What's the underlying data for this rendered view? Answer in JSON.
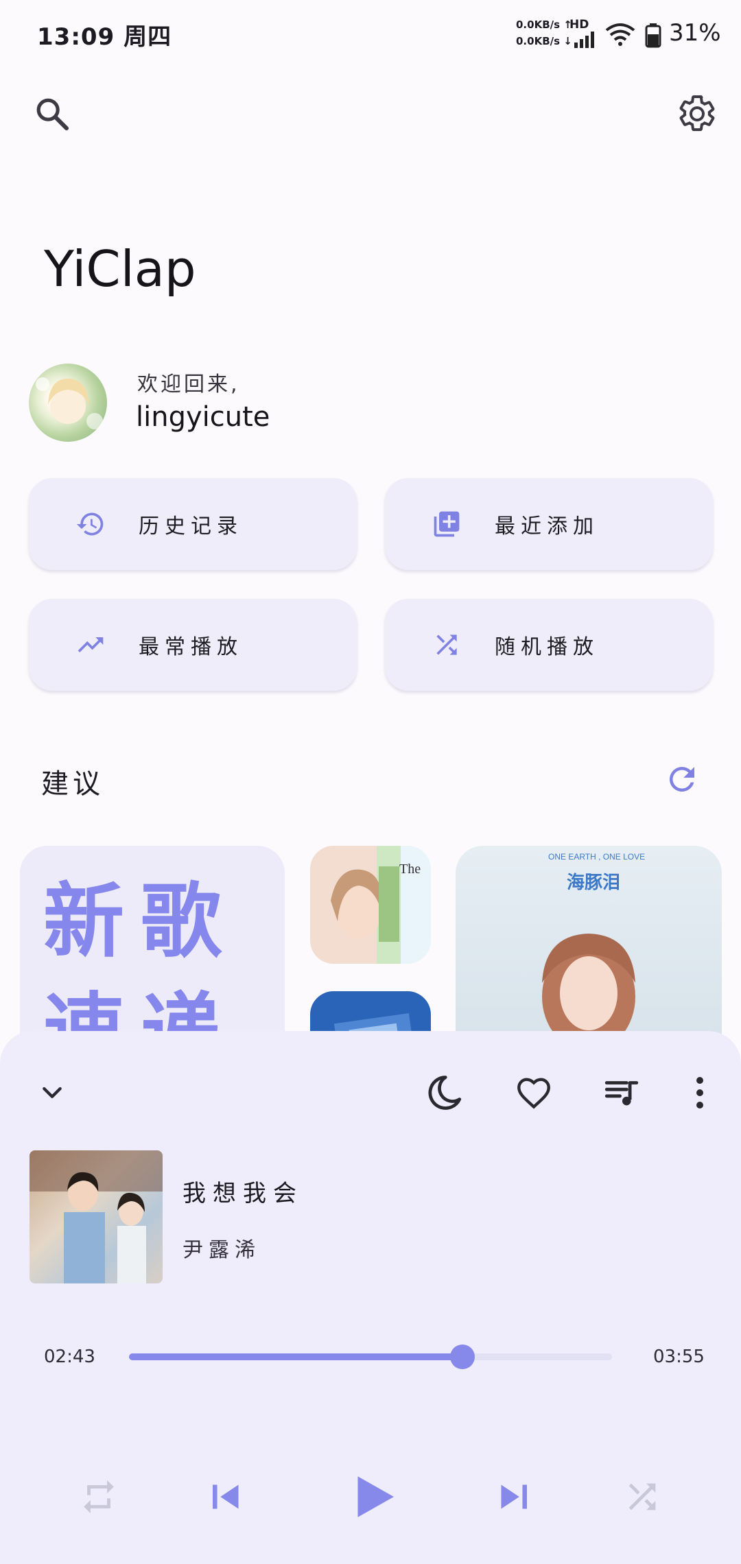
{
  "status_bar": {
    "time": "13:09",
    "weekday": "周四",
    "net_up": "0.0KB/s ↑",
    "net_down": "0.0KB/s ↓",
    "hd": "HD",
    "battery": "31%"
  },
  "header": {
    "search_icon": "search-icon",
    "settings_icon": "gear-icon"
  },
  "app": {
    "title": "YiClap"
  },
  "user": {
    "greeting": "欢迎回来,",
    "name": "lingyicute"
  },
  "quick_actions": [
    {
      "label": "历史记录",
      "icon": "history-icon"
    },
    {
      "label": "最近添加",
      "icon": "library-add-icon"
    },
    {
      "label": "最常播放",
      "icon": "trending-up-icon"
    },
    {
      "label": "随机播放",
      "icon": "shuffle-icon"
    }
  ],
  "suggestions": {
    "title": "建议",
    "refresh_icon": "refresh-icon",
    "big_card_text": "新歌速递"
  },
  "player": {
    "song_title": "我想我会",
    "artist": "尹露浠",
    "current_time": "02:43",
    "total_time": "03:55",
    "progress": 0.69,
    "accent": "#8688ea"
  }
}
